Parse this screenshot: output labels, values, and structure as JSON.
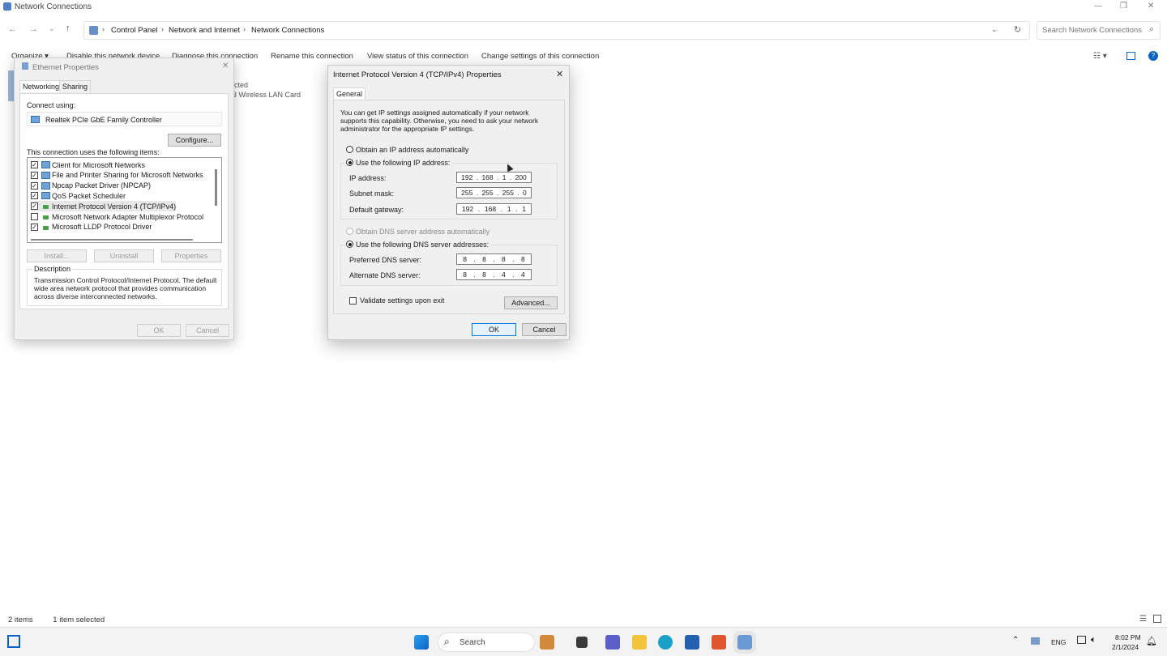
{
  "window": {
    "title": "Network Connections",
    "breadcrumb": [
      "Control Panel",
      "Network and Internet",
      "Network Connections"
    ],
    "search_placeholder": "Search Network Connections"
  },
  "commandbar": {
    "organize": "Organize ▾",
    "disable": "Disable this network device",
    "diagnose": "Diagnose this connection",
    "rename": "Rename this connection",
    "view_status": "View status of this connection",
    "change_settings": "Change settings of this connection"
  },
  "background_items": {
    "status_fragment": "cted",
    "card_fragment": "3 Wireless LAN Card"
  },
  "statusbar": {
    "items": "2 items",
    "selected": "1 item selected"
  },
  "ethernet_dialog": {
    "title": "Ethernet Properties",
    "tabs": [
      "Networking",
      "Sharing"
    ],
    "connect_using_label": "Connect using:",
    "adapter": "Realtek PCIe GbE Family Controller",
    "configure": "Configure...",
    "items_label": "This connection uses the following items:",
    "items": [
      {
        "label": "Client for Microsoft Networks",
        "checked": true,
        "icon": "network-client-icon"
      },
      {
        "label": "File and Printer Sharing for Microsoft Networks",
        "checked": true,
        "icon": "network-service-icon"
      },
      {
        "label": "Npcap Packet Driver (NPCAP)",
        "checked": true,
        "icon": "network-service-icon"
      },
      {
        "label": "QoS Packet Scheduler",
        "checked": true,
        "icon": "network-service-icon"
      },
      {
        "label": "Internet Protocol Version 4 (TCP/IPv4)",
        "checked": true,
        "icon": "protocol-icon"
      },
      {
        "label": "Microsoft Network Adapter Multiplexor Protocol",
        "checked": false,
        "icon": "protocol-icon"
      },
      {
        "label": "Microsoft LLDP Protocol Driver",
        "checked": true,
        "icon": "protocol-icon"
      }
    ],
    "install": "Install...",
    "uninstall": "Uninstall",
    "properties": "Properties",
    "description_label": "Description",
    "description": "Transmission Control Protocol/Internet Protocol. The default wide area network protocol that provides communication across diverse interconnected networks.",
    "ok": "OK",
    "cancel": "Cancel"
  },
  "ipv4_dialog": {
    "title": "Internet Protocol Version 4 (TCP/IPv4) Properties",
    "tab": "General",
    "intro": "You can get IP settings assigned automatically if your network supports this capability. Otherwise, you need to ask your network administrator for the appropriate IP settings.",
    "obtain_ip_auto": "Obtain an IP address automatically",
    "use_following_ip": "Use the following IP address:",
    "ip_label": "IP address:",
    "ip": [
      "192",
      "168",
      "1",
      "200"
    ],
    "subnet_label": "Subnet mask:",
    "subnet": [
      "255",
      "255",
      "255",
      "0"
    ],
    "gateway_label": "Default gateway:",
    "gateway": [
      "192",
      "168",
      "1",
      "1"
    ],
    "obtain_dns_auto": "Obtain DNS server address automatically",
    "use_following_dns": "Use the following DNS server addresses:",
    "preferred_dns_label": "Preferred DNS server:",
    "preferred_dns": [
      "8",
      "8",
      "8",
      "8"
    ],
    "alternate_dns_label": "Alternate DNS server:",
    "alternate_dns": [
      "8",
      "8",
      "4",
      "4"
    ],
    "validate": "Validate settings upon exit",
    "advanced": "Advanced...",
    "ok": "OK",
    "cancel": "Cancel"
  },
  "taskbar": {
    "search": "Search",
    "language": "ENG",
    "time": "8:02 PM",
    "date": "2/1/2024"
  },
  "colors": {
    "accent": "#0078d7",
    "dialog_bg": "#f0f0f0"
  }
}
